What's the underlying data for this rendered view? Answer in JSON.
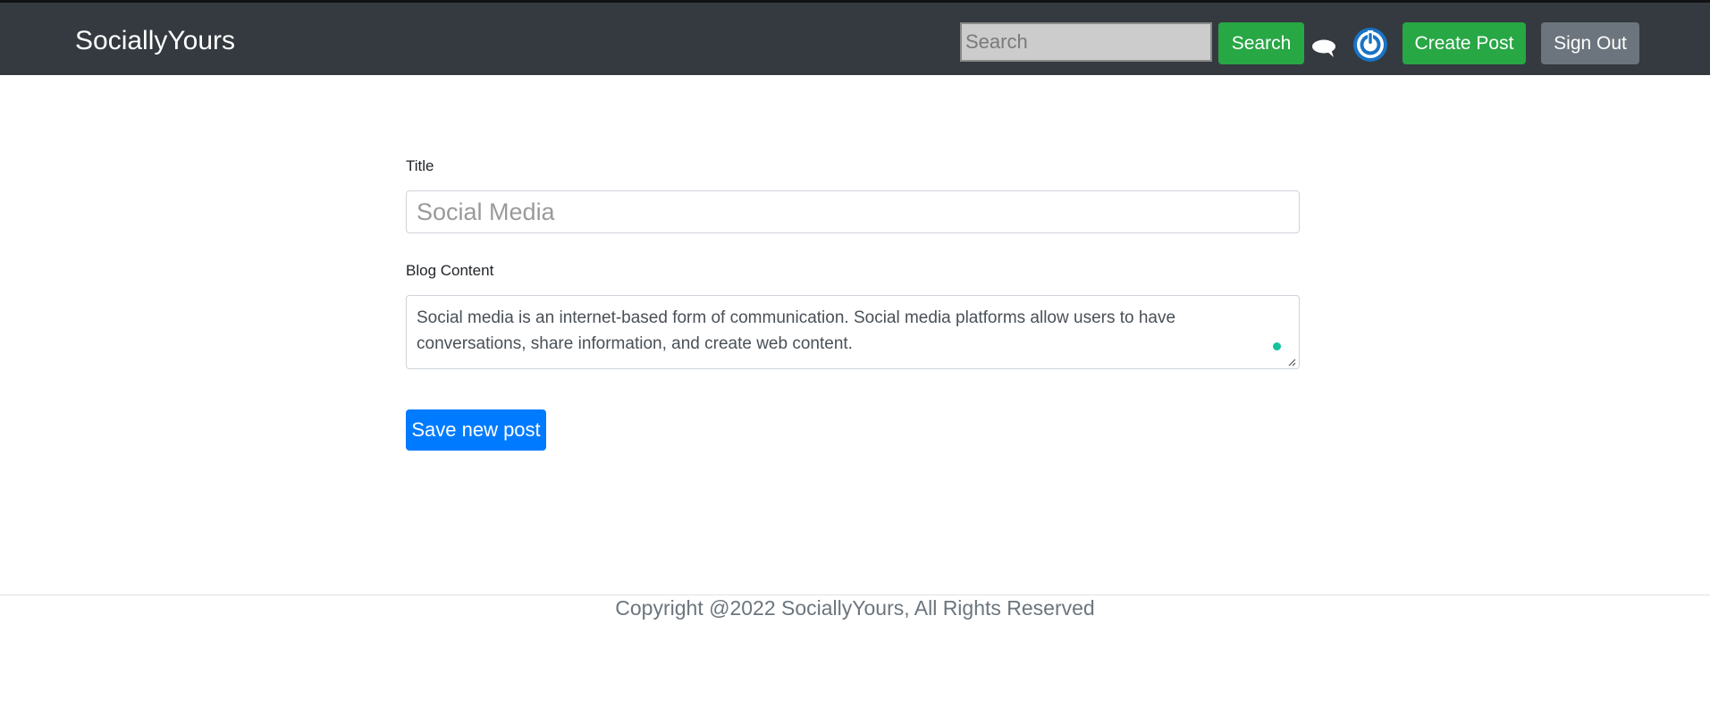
{
  "navbar": {
    "brand": "SociallyYours",
    "search": {
      "placeholder": "Search",
      "value": ""
    },
    "search_button_label": "Search",
    "create_post_label": "Create Post",
    "sign_out_label": "Sign Out",
    "icons": [
      "chat-bubble-icon",
      "power-icon"
    ]
  },
  "form": {
    "title_label": "Title",
    "title_placeholder": "Social Media",
    "content_label": "Blog Content",
    "content_value": "Social media is an internet-based form of communication. Social media platforms allow users to have conversations, share information, and create web content.",
    "save_button_label": "Save new post"
  },
  "footer": {
    "copyright": "Copyright @2022 SociallyYours, All Rights Reserved"
  },
  "colors": {
    "navbar_bg": "#343a40",
    "success": "#28a745",
    "secondary": "#6c757d",
    "primary": "#007bff",
    "power_icon": "#1a73c5",
    "grammar_dot": "#15c39a"
  }
}
